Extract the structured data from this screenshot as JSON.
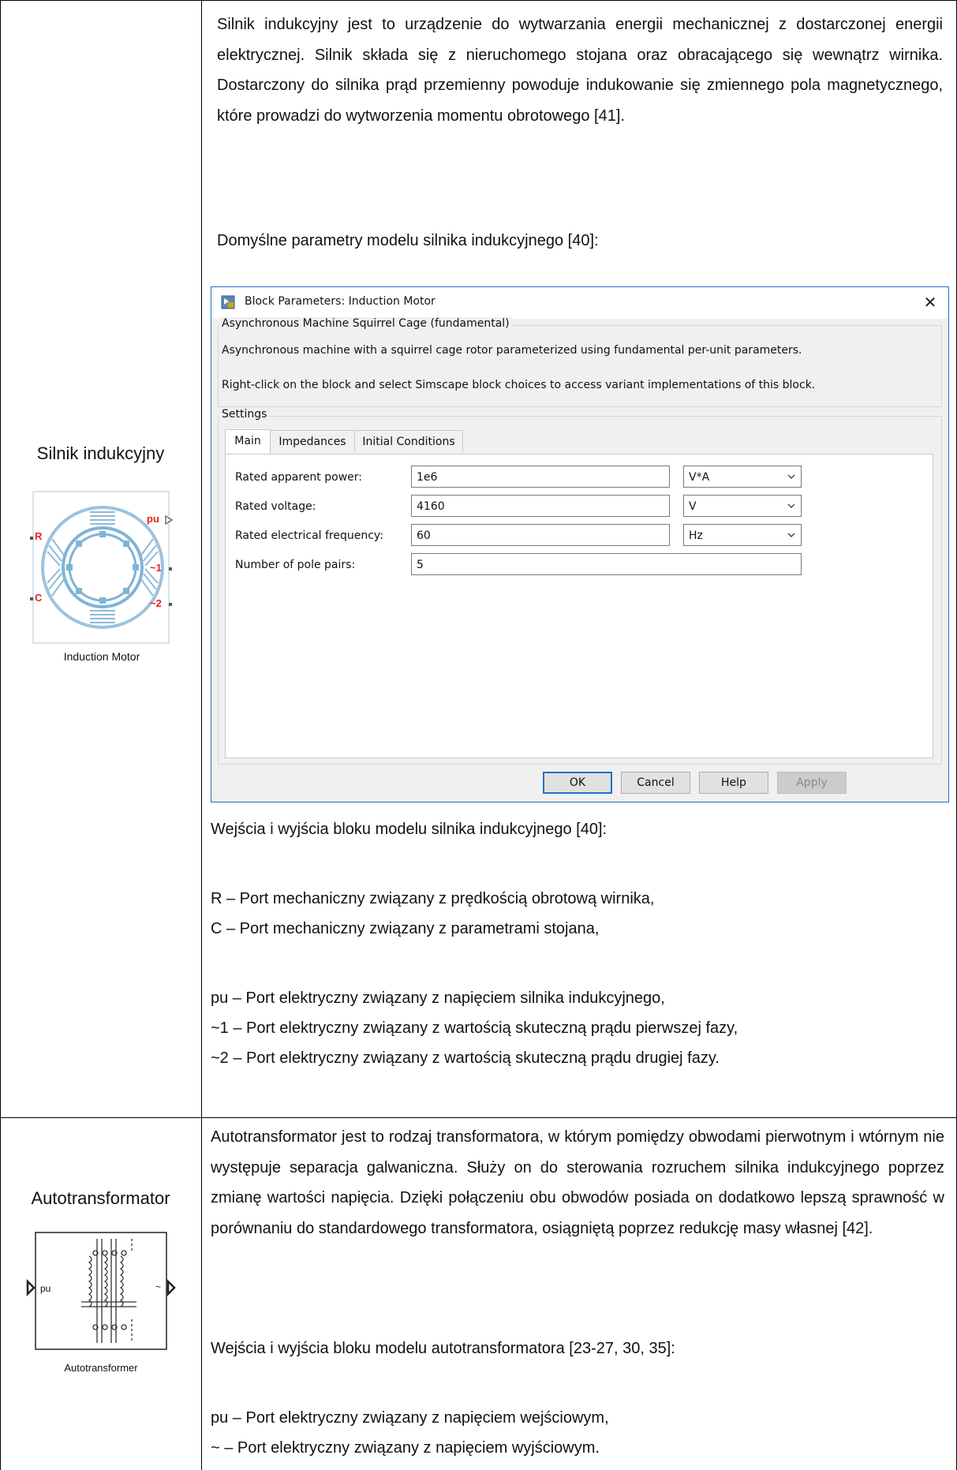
{
  "row1": {
    "label": "Silnik indukcyjny",
    "description": "Silnik indukcyjny jest to urządzenie do wytwarzania energii mechanicznej z dostarczonej energii elektrycznej. Silnik składa się z nieruchomego stojana oraz obracającego się wewnątrz wirnika. Dostarczony do silnika prąd przemienny powoduje indukowanie się zmiennego pola magnetycznego, które prowadzi do wytworzenia momentu obrotowego [41].",
    "defaults_intro": "Domyślne parametry modelu silnika indukcyjnego [40]:",
    "block": {
      "caption": "Induction Motor",
      "ports": {
        "r": "R",
        "c": "C",
        "pu": "pu",
        "p1": "~1",
        "p2": "~2"
      }
    },
    "io_intro": "Wejścia i wyjścia bloku modelu silnika indukcyjnego [40]:",
    "io_mech": [
      "R – Port mechaniczny związany z prędkością obrotową wirnika,",
      "C – Port mechaniczny związany z parametrami stojana,"
    ],
    "io_elec": [
      "pu – Port elektryczny związany z napięciem silnika indukcyjnego,",
      "~1 – Port elektryczny związany z wartością skuteczną prądu pierwszej fazy,",
      "~2 – Port elektryczny związany z wartością skuteczną prądu drugiej fazy."
    ]
  },
  "dialog": {
    "title": "Block Parameters: Induction Motor",
    "close_glyph": "✕",
    "group1_legend": "Asynchronous Machine Squirrel Cage (fundamental)",
    "desc1": "Asynchronous machine with a squirrel cage rotor parameterized using fundamental per-unit parameters.",
    "desc2": "Right-click on the block and select Simscape block choices to access variant implementations of this block.",
    "settings_legend": "Settings",
    "tabs": [
      "Main",
      "Impedances",
      "Initial Conditions"
    ],
    "params": [
      {
        "label": "Rated apparent power:",
        "value": "1e6",
        "unit": "V*A"
      },
      {
        "label": "Rated voltage:",
        "value": "4160",
        "unit": "V"
      },
      {
        "label": "Rated electrical frequency:",
        "value": "60",
        "unit": "Hz"
      },
      {
        "label": "Number of pole pairs:",
        "value": "5"
      }
    ],
    "buttons": {
      "ok": "OK",
      "cancel": "Cancel",
      "help": "Help",
      "apply": "Apply"
    }
  },
  "row2": {
    "label": "Autotransformator",
    "description": "Autotransformator jest to rodzaj transformatora, w którym pomiędzy obwodami pierwotnym i wtórnym nie występuje separacja galwaniczna. Służy on do sterowania rozruchem silnika indukcyjnego poprzez zmianę wartości napięcia. Dzięki połączeniu obu obwodów posiada on dodatkowo lepszą sprawność w porównaniu do standardowego transformatora, osiągniętą poprzez redukcję masy własnej [42].",
    "block": {
      "caption": "Autotransformer",
      "port_in": "pu",
      "port_out": "~"
    },
    "io_intro": "Wejścia i wyjścia bloku modelu autotransformatora [23-27, 30, 35]:",
    "io": [
      "pu – Port elektryczny związany z napięciem wejściowym,",
      "~ – Port elektryczny związany z napięciem wyjściowym."
    ]
  }
}
